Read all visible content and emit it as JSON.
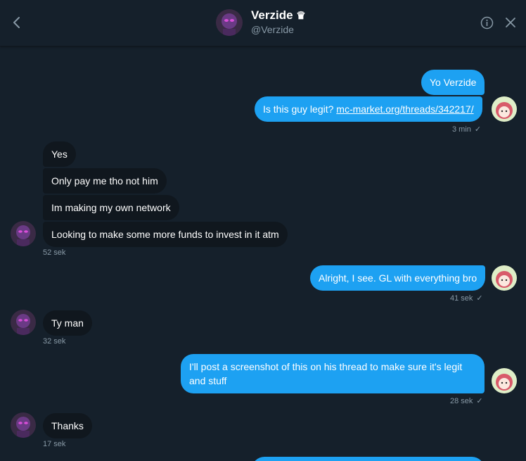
{
  "header": {
    "name": "Verzide",
    "crown": "♛",
    "handle": "@Verzide",
    "back_icon": "chevron-left-icon",
    "info_icon": "info-icon",
    "close_icon": "close-icon"
  },
  "colors": {
    "background": "#15202b",
    "outgoing": "#1da1f2",
    "incoming": "#10171e",
    "muted": "#8899a6"
  },
  "messages": [
    {
      "dir": "out",
      "text": "Yo Verzide"
    },
    {
      "dir": "out",
      "text_prefix": "Is this guy legit? ",
      "link": "mc-market.org/threads/342217/",
      "time": "3 min",
      "check": "✓"
    },
    {
      "dir": "in",
      "text": "Yes"
    },
    {
      "dir": "in",
      "text": "Only pay me tho not him"
    },
    {
      "dir": "in",
      "text": "Im making my own network"
    },
    {
      "dir": "in",
      "text": "Looking to make some more funds to invest in it atm",
      "time": "52 sek"
    },
    {
      "dir": "out",
      "text": "Alright, I see. GL with everything bro",
      "time": "41 sek",
      "check": "✓"
    },
    {
      "dir": "in",
      "text": "Ty man",
      "time": "32 sek"
    },
    {
      "dir": "out",
      "text_line1": "I'll post a screenshot of this on his thread to make sure it's legit",
      "text_line2": "and stuff",
      "time": "28 sek",
      "check": "✓"
    },
    {
      "dir": "in",
      "text": "Thanks",
      "time": "17 sek"
    }
  ]
}
